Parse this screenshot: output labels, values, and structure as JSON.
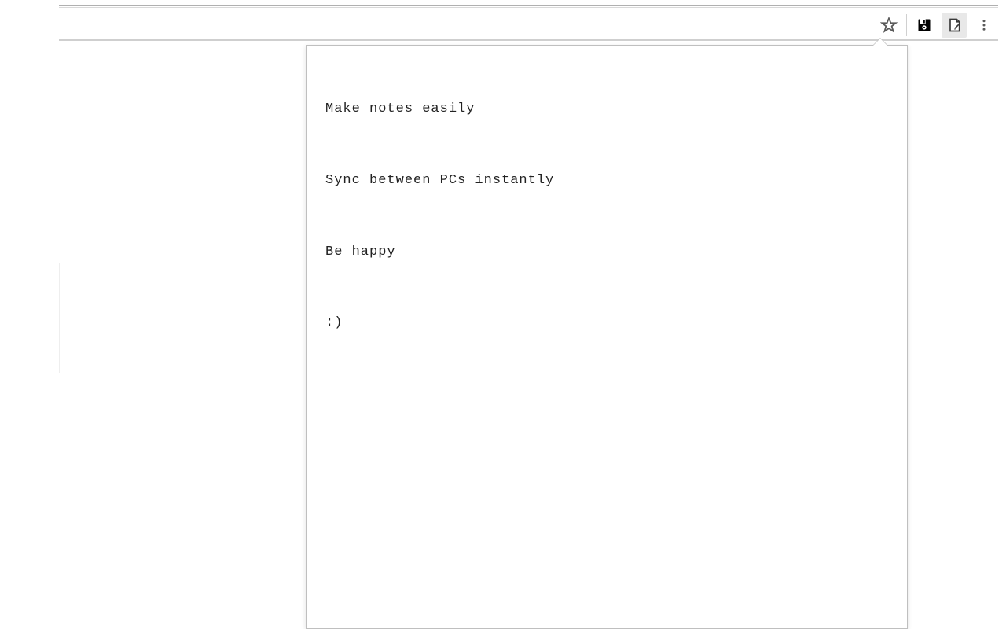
{
  "toolbar": {
    "icons": {
      "bookmark": "bookmark-star-icon",
      "ext1": "save-disk-icon",
      "ext2_active": "note-page-icon",
      "menu": "vertical-dots-icon"
    }
  },
  "popup": {
    "note_lines": [
      "Make notes easily",
      "Sync between PCs instantly",
      "Be happy",
      ":)"
    ]
  }
}
